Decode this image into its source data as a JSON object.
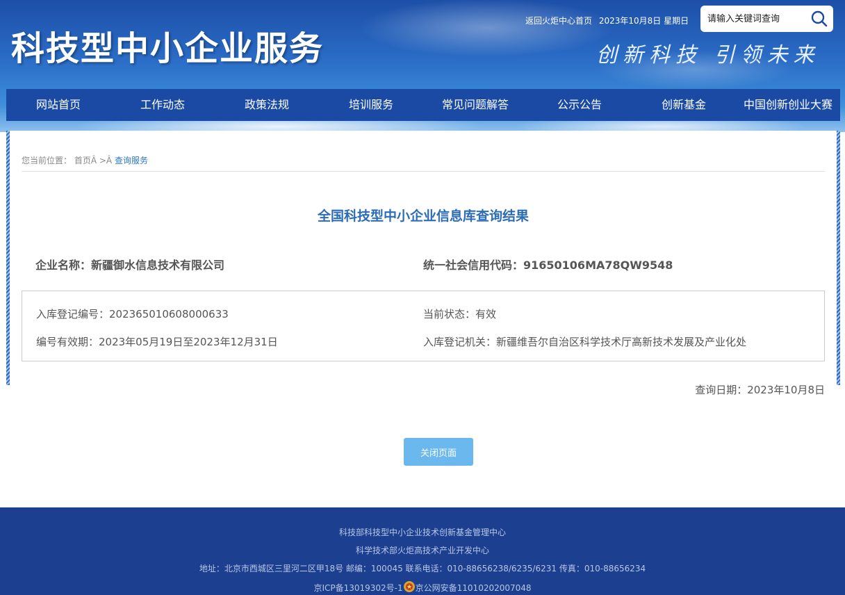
{
  "header": {
    "site_title": "科技型中小企业服务",
    "home_link": "返回火炬中心首页",
    "date_text": "2023年10月8日  星期日",
    "search_placeholder": "请输入关键词查询",
    "slogan": "创新科技  引领未来"
  },
  "nav": {
    "items": [
      {
        "label": "网站首页"
      },
      {
        "label": "工作动态"
      },
      {
        "label": "政策法规"
      },
      {
        "label": "培训服务"
      },
      {
        "label": "常见问题解答"
      },
      {
        "label": "公示公告"
      },
      {
        "label": "创新基金"
      },
      {
        "label": "中国创新创业大赛"
      }
    ]
  },
  "breadcrumb": {
    "prefix": "您当前位置：",
    "home": "首页Â",
    "separator": " >Â ",
    "current": "查询服务"
  },
  "result": {
    "title": "全国科技型中小企业信息库查询结果",
    "company_name": "企业名称：新疆御水信息技术有限公司",
    "credit_code": "统一社会信用代码：91650106MA78QW9548",
    "reg_number": "入库登记编号：202365010608000633",
    "status": "当前状态：有效",
    "validity": "编号有效期：2023年05月19日至2023年12月31日",
    "authority": "入库登记机关：新疆维吾尔自治区科学技术厅高新技术发展及产业化处",
    "query_date": "查询日期：2023年10月8日",
    "close_button": "关闭页面"
  },
  "footer": {
    "line1": "科技部科技型中小企业技术创新基金管理中心",
    "line2": "科学技术部火炬高技术产业开发中心",
    "line3": "地址：北京市西城区三里河二区甲18号 邮编：100045 联系电话：010-88656238/6235/6231 传真：010-88656234",
    "icp": "京ICP备13019302号-1",
    "police": "京公网安备11010202007048"
  },
  "colors": {
    "nav_bg": "#1a4aa3",
    "title_blue": "#2b6cb8",
    "button_blue": "#6ab8ee",
    "footer_bg": "#1c3f8f"
  }
}
